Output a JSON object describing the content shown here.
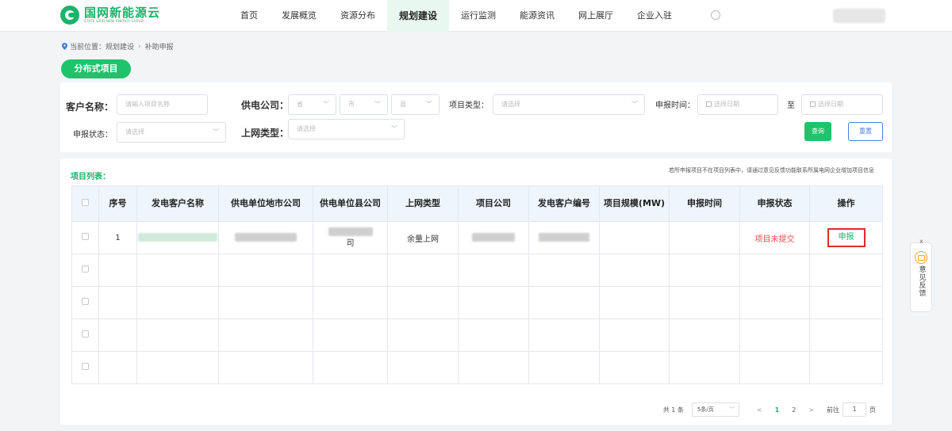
{
  "header": {
    "brand_cn": "国网新能源云",
    "brand_en": "STATE GRID NEW ENERGY CLOUD",
    "nav": [
      "首页",
      "发展概览",
      "资源分布",
      "规划建设",
      "运行监测",
      "能源资讯",
      "网上展厅",
      "企业入驻"
    ],
    "active_nav": "规划建设"
  },
  "breadcrumb": {
    "prefix": "当前位置：",
    "items": [
      "规划建设",
      "补助申报"
    ],
    "separator": "›"
  },
  "tab": {
    "label": "分布式项目"
  },
  "filters": {
    "customer_label": "客户名称：",
    "customer_placeholder": "请输入项目名称",
    "company_label": "供电公司：",
    "province_placeholder": "省",
    "city_placeholder": "市",
    "county_placeholder": "县",
    "project_type_label": "项目类型：",
    "project_type_placeholder": "请选择",
    "time_label": "申报时间：",
    "start_placeholder": "选择日期",
    "to": "至",
    "end_placeholder": "选择日期",
    "status_label": "申报状态：",
    "status_placeholder": "请选择",
    "grid_type_label": "上网类型：",
    "grid_type_placeholder": "请选择",
    "query_btn": "查询",
    "reset_btn": "重置"
  },
  "list": {
    "title": "项目列表：",
    "notice": "若所申报项目不在项目列表中，请通过意见反馈功能联系所属电网企业增加项目信息",
    "columns": [
      "序号",
      "发电客户名称",
      "供电单位地市公司",
      "供电单位县公司",
      "上网类型",
      "项目公司",
      "发电客户编号",
      "项目规模(MW)",
      "申报时间",
      "申报状态",
      "操作"
    ],
    "rows": [
      {
        "index": "1",
        "grid_type": "余量上网",
        "status": "项目未提交",
        "action": "申报",
        "county_suffix": "司"
      }
    ]
  },
  "pagination": {
    "total": "共 1 条",
    "page_size": "5条/页",
    "prev": "<",
    "pages": [
      "1",
      "2"
    ],
    "next": ">",
    "goto_prefix": "前往",
    "goto_value": "1",
    "goto_suffix": "页"
  },
  "feedback": {
    "close": "x",
    "label": "意见反馈"
  },
  "colors": {
    "brand_green": "#1bb36a",
    "pill_green": "#1ec36b",
    "status_red": "#e84d4d",
    "action_border": "#e02a2a",
    "reset_blue": "#4a7ee0"
  }
}
